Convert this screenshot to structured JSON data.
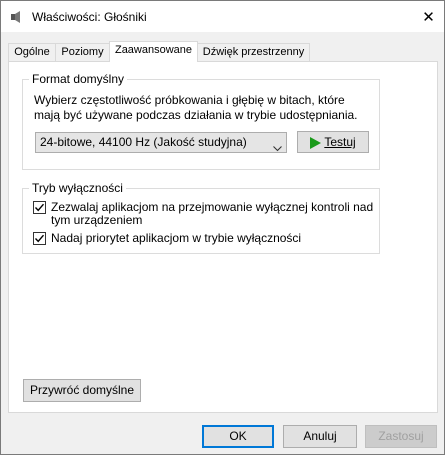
{
  "window": {
    "title": "Właściwości: Głośniki",
    "close_glyph": "✕"
  },
  "tabs": [
    {
      "label": "Ogólne",
      "active": false
    },
    {
      "label": "Poziomy",
      "active": false
    },
    {
      "label": "Zaawansowane",
      "active": true
    },
    {
      "label": "Dźwięk przestrzenny",
      "active": false
    }
  ],
  "format_group": {
    "title": "Format domyślny",
    "description": "Wybierz częstotliwość próbkowania i głębię w bitach, które mają być używane podczas działania w trybie udostępniania.",
    "selected_format": "24-bitowe, 44100 Hz (Jakość studyjna)",
    "test_button": "Testuj"
  },
  "exclusive_group": {
    "title": "Tryb wyłączności",
    "options": [
      {
        "line1": "Zezwalaj aplikacjom na przejmowanie wyłącznej kontroli nad",
        "line2": "tym urządzeniem",
        "checked": true
      },
      {
        "line1": "Nadaj priorytet aplikacjom w trybie wyłączności",
        "checked": true
      }
    ]
  },
  "restore_button": "Przywróć domyślne",
  "footer": {
    "ok": "OK",
    "cancel": "Anuluj",
    "apply": "Zastosuj"
  },
  "colors": {
    "accent": "#0078d7",
    "play": "#1a9a1a",
    "close_hover": "#e81123"
  },
  "icons": {
    "title": "speaker-properties-icon",
    "dropdown": "chevron-down-icon",
    "test": "play-icon",
    "check": "checkmark-icon"
  }
}
